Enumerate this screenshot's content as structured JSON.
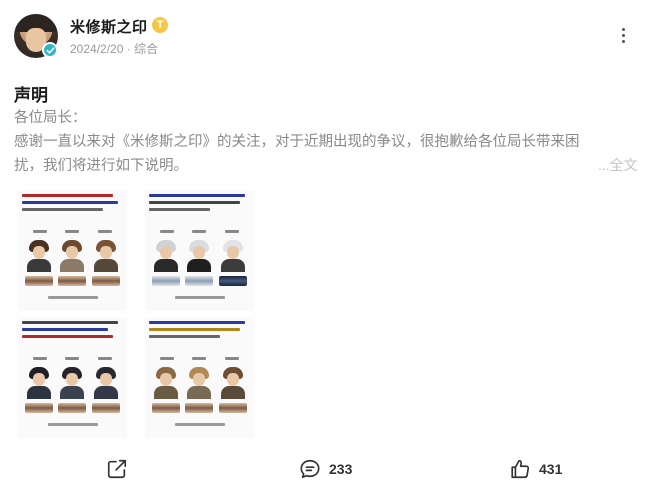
{
  "post": {
    "author": {
      "name": "米修斯之印",
      "badge": "T"
    },
    "date": "2024/2/20",
    "separator": "·",
    "category": "综合",
    "title": "声明",
    "body": {
      "greeting": "各位局长：",
      "line1": "感谢一直以来对《米修斯之印》的关注，对于近期出现的争议，很抱歉给各位局长带来困",
      "line2": "扰，我们将进行如下说明。"
    },
    "full_text_link": "...全文",
    "actions": {
      "comment_count": "233",
      "like_count": "431"
    }
  },
  "colors": {
    "verified": "#2fb7c6",
    "badge": "#f6c649",
    "text_muted": "#8a8a8a"
  },
  "icons": [
    "more-vertical-icon",
    "verified-icon",
    "share-icon",
    "comment-icon",
    "like-icon"
  ]
}
